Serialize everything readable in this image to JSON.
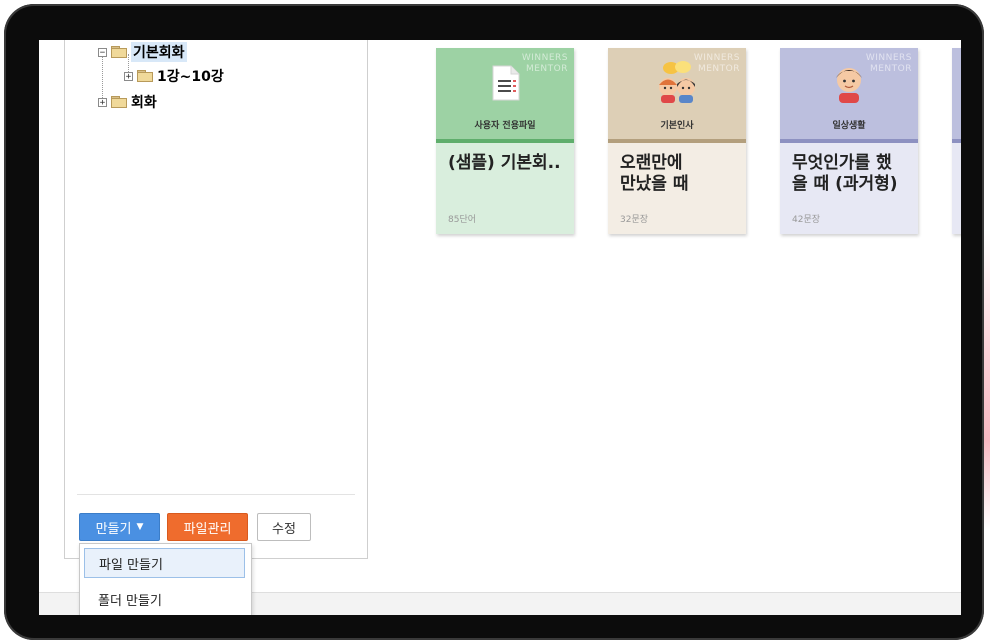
{
  "tree": {
    "items": [
      {
        "label": "기본회화",
        "expander": "−",
        "selected": true
      },
      {
        "label": "1강~10강",
        "expander": "+"
      },
      {
        "label": "회화",
        "expander": "+"
      }
    ]
  },
  "toolbar": {
    "make_label": "만들기",
    "make_caret": "▼",
    "files_label": "파일관리",
    "edit_label": "수정"
  },
  "make_menu": {
    "items": [
      {
        "label": "파일 만들기"
      },
      {
        "label": "폴더 만들기"
      }
    ]
  },
  "cards": [
    {
      "watermark": [
        "WINNERS",
        "MENTOR"
      ],
      "icon": "document-icon",
      "category": "사용자 전용파일",
      "title": "(샘플) 기본회..",
      "count": "85단어",
      "color": "#9dd2a4"
    },
    {
      "watermark": [
        "WINNERS",
        "MENTOR"
      ],
      "icon": "two-kids-chat-icon",
      "category": "기본인사",
      "title": "오랜만에\n만났을 때",
      "count": "32문장",
      "color": "#ddcfb6"
    },
    {
      "watermark": [
        "WINNERS",
        "MENTOR"
      ],
      "icon": "boy-face-icon",
      "category": "일상생활",
      "title": "무엇인가를 했\n을 때 (과거형)",
      "count": "42문장",
      "color": "#bcbfde"
    }
  ]
}
